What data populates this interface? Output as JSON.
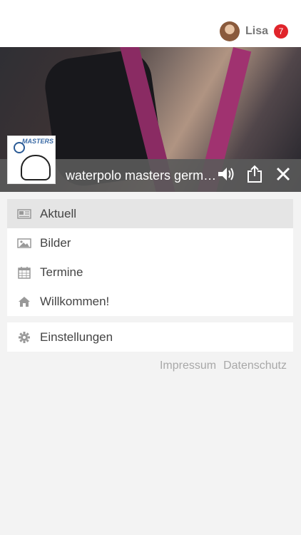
{
  "header": {
    "user_name": "Lisa",
    "notification_count": "7"
  },
  "hero": {
    "title": "waterpolo masters germany",
    "logo_text": "MASTERS"
  },
  "menu": {
    "items": [
      {
        "label": "Aktuell",
        "icon": "newspaper-icon"
      },
      {
        "label": "Bilder",
        "icon": "image-icon"
      },
      {
        "label": "Termine",
        "icon": "calendar-icon"
      },
      {
        "label": "Willkommen!",
        "icon": "home-icon"
      }
    ]
  },
  "settings": {
    "label": "Einstellungen",
    "icon": "gear-icon"
  },
  "footer": {
    "impressum": "Impressum",
    "datenschutz": "Datenschutz"
  }
}
